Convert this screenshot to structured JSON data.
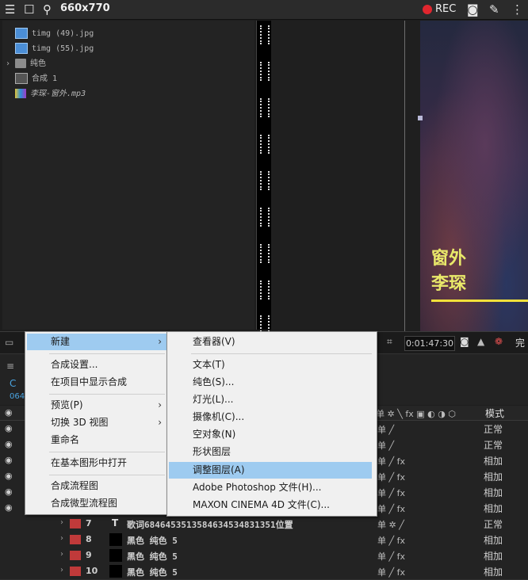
{
  "recorder": {
    "title": "660x770",
    "rec_label": "REC"
  },
  "project": {
    "items": [
      {
        "label": "timg (49).jpg",
        "icon": "jpg-file-icon"
      },
      {
        "label": "timg (55).jpg",
        "icon": "jpg-file-icon"
      },
      {
        "label": "纯色",
        "icon": "folder-icon"
      },
      {
        "label": "合成 1",
        "icon": "composition-icon"
      },
      {
        "label": "李琛-窗外.mp3",
        "icon": "audio-file-icon"
      }
    ]
  },
  "preview": {
    "lyric_line1": "窗外",
    "lyric_line2": "李琛"
  },
  "viewer_toolbar": {
    "timecode": "0:01:47:30",
    "cut_text": "完"
  },
  "timeline": {
    "mode_header": "模式",
    "rows": [
      {
        "mode": "正常"
      },
      {
        "mode": "正常"
      },
      {
        "mode": "相加"
      },
      {
        "mode": "相加"
      },
      {
        "mode": "相加"
      },
      {
        "mode": "相加"
      },
      {
        "num": "7",
        "name": "歌词6846453513584634534831351位置",
        "mode": "正常",
        "type_icon": "T"
      },
      {
        "num": "8",
        "name": "黑色 纯色 5",
        "mode": "相加"
      },
      {
        "num": "9",
        "name": "黑色 纯色 5",
        "mode": "相加"
      },
      {
        "num": "10",
        "name": "黑色 纯色 5",
        "mode": "相加"
      }
    ]
  },
  "context_menu": {
    "items": [
      {
        "label": "新建",
        "has_submenu": true,
        "highlighted": true
      },
      {
        "label": "合成设置..."
      },
      {
        "label": "在项目中显示合成"
      },
      {
        "label": "预览(P)",
        "has_submenu": true
      },
      {
        "label": "切换 3D 视图",
        "has_submenu": true
      },
      {
        "label": "重命名"
      },
      {
        "label": "在基本图形中打开"
      },
      {
        "label": "合成流程图"
      },
      {
        "label": "合成微型流程图"
      }
    ]
  },
  "submenu": {
    "items": [
      {
        "label": "查看器(V)"
      },
      {
        "label": "文本(T)"
      },
      {
        "label": "纯色(S)..."
      },
      {
        "label": "灯光(L)..."
      },
      {
        "label": "摄像机(C)..."
      },
      {
        "label": "空对象(N)"
      },
      {
        "label": "形状图层"
      },
      {
        "label": "调整图层(A)",
        "highlighted": true
      },
      {
        "label": "Adobe Photoshop 文件(H)..."
      },
      {
        "label": "MAXON CINEMA 4D 文件(C)..."
      }
    ]
  },
  "colors": {
    "accent_highlight": "#9ecbf0",
    "lyric": "#e9e96a",
    "rec": "#e0262e",
    "label_red": "#c03a3a"
  }
}
